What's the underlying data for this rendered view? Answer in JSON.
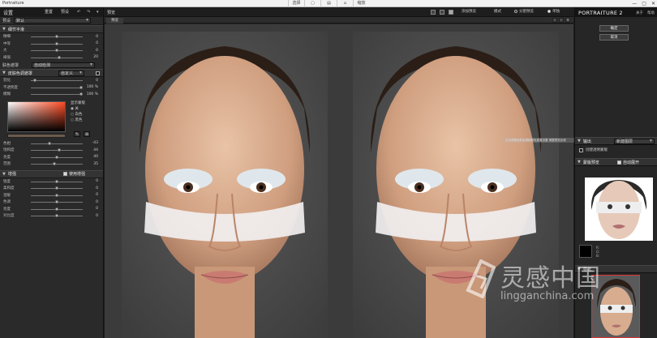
{
  "window": {
    "title": "Portraiture",
    "toolbar_center": [
      "选择",
      "",
      "",
      "",
      "缩放"
    ],
    "controls": [
      "—",
      "▢",
      "✕"
    ]
  },
  "left": {
    "header_title": "设置",
    "header_btn_reset": "重置",
    "header_btn_preset": "预设",
    "preset_label": "预设",
    "preset_value": "默认",
    "detail_section": "细节平滑",
    "detail_sliders": [
      {
        "label": "精细",
        "value": "0",
        "pct": 0.5
      },
      {
        "label": "中等",
        "value": "0",
        "pct": 0.5
      },
      {
        "label": "大",
        "value": "0",
        "pct": 0.5
      },
      {
        "label": "阈值",
        "value": "20",
        "pct": 0.55
      }
    ],
    "mask_label": "肤色遮罩",
    "mask_value": "自动检测",
    "skin_section": "皮肤色调遮罩",
    "skin_mode": "自定义",
    "skin_sliders": [
      {
        "label": "羽化",
        "value": "0",
        "pct": 0.05
      },
      {
        "label": "不透明度",
        "value": "100 %",
        "pct": 1.0
      },
      {
        "label": "模糊",
        "value": "100 %",
        "pct": 1.0
      }
    ],
    "picker_options_title": "显示蒙版",
    "picker_options": [
      "关",
      "白色",
      "黑色"
    ],
    "hue_sliders": [
      {
        "label": "色相",
        "value": "-43",
        "pct": 0.35
      },
      {
        "label": "饱和度",
        "value": "44",
        "pct": 0.55
      },
      {
        "label": "亮度",
        "value": "40",
        "pct": 0.5
      },
      {
        "label": "范围",
        "value": "35",
        "pct": 0.45
      }
    ],
    "enhance_section": "增强",
    "enhance_use": "使用增强",
    "enhance_sliders": [
      {
        "label": "锐度",
        "value": "0",
        "pct": 0.5
      },
      {
        "label": "柔和度",
        "value": "0",
        "pct": 0.5
      },
      {
        "label": "温暖",
        "value": "0",
        "pct": 0.5
      },
      {
        "label": "色调",
        "value": "0",
        "pct": 0.5
      },
      {
        "label": "亮度",
        "value": "0",
        "pct": 0.5
      },
      {
        "label": "对比度",
        "value": "0",
        "pct": 0.5
      }
    ]
  },
  "center": {
    "title": "预览",
    "tab": "预览",
    "add_preview": "添加预览",
    "mode_label": "模式",
    "radio_split": "分割预览",
    "radio_single": "单独",
    "tooltip": "点击调整皮肤色调和颜色遮罩设置 调整预览区域"
  },
  "right": {
    "brand": "PORTRAITURE",
    "version": "2",
    "link_about": "关于",
    "link_help": "帮助",
    "btn_ok": "确定",
    "btn_cancel": "取消",
    "output_section": "输出",
    "output_value": "新建图层",
    "create_mask_label": "创建透明蒙版",
    "mask_preview_section": "蒙版预览",
    "auto_open": "自动展开",
    "swatch_values": [
      "R:",
      "G:",
      "B:",
      "L:"
    ],
    "nav_section": "导航"
  },
  "watermark": {
    "cn": "灵感中国",
    "en": "lingganchina.com"
  },
  "colors": {
    "accent_red": "#d33333",
    "panel_bg": "#2a2a2a",
    "header_bg": "#1a1a1a"
  }
}
